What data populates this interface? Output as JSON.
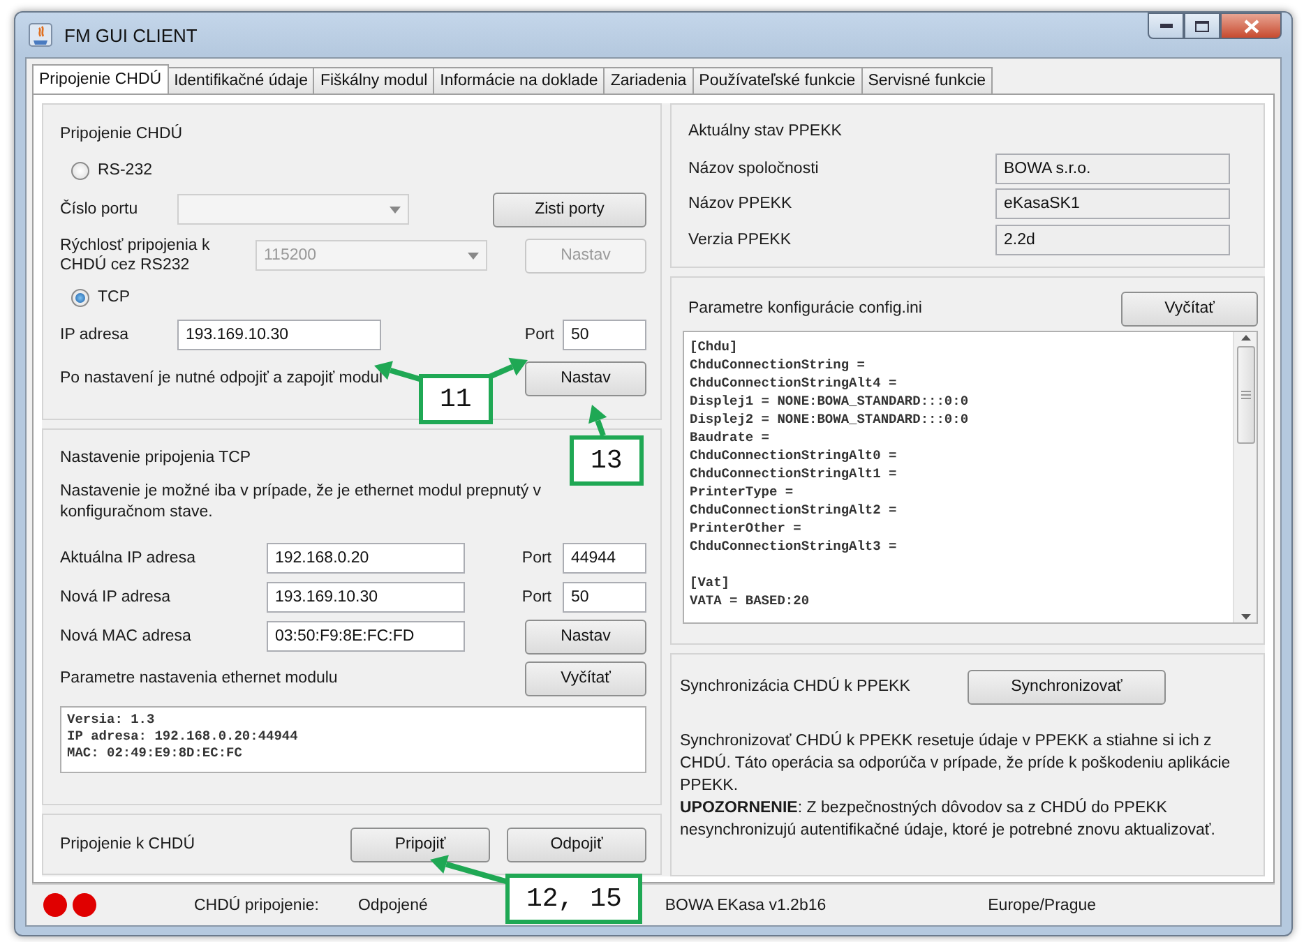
{
  "window": {
    "title": "FM GUI CLIENT"
  },
  "tabs": [
    {
      "label": "Pripojenie CHDÚ",
      "selected": true
    },
    {
      "label": "Identifikačné údaje",
      "selected": false
    },
    {
      "label": "Fiškálny modul",
      "selected": false
    },
    {
      "label": "Informácie na doklade",
      "selected": false
    },
    {
      "label": "Zariadenia",
      "selected": false
    },
    {
      "label": "Používateľské funkcie",
      "selected": false
    },
    {
      "label": "Servisné funkcie",
      "selected": false
    }
  ],
  "connection": {
    "title": "Pripojenie CHDÚ",
    "rs232": {
      "label": "RS-232",
      "selected": false
    },
    "port": {
      "label": "Číslo portu",
      "disabled": true
    },
    "detect_button": {
      "label": "Zisti porty",
      "disabled": false
    },
    "speed": {
      "label": "Rýchlosť pripojenia k CHDÚ cez RS232",
      "value": "115200",
      "disabled": true
    },
    "speed_button": {
      "label": "Nastav",
      "disabled": true
    },
    "tcp": {
      "label": "TCP",
      "selected": true
    },
    "ip": {
      "label": "IP adresa",
      "value": "193.169.10.30"
    },
    "tcp_port": {
      "label": "Port",
      "value": "50"
    },
    "note": "Po nastavení je nutné odpojiť a zapojiť modul",
    "set_button": {
      "label": "Nastav",
      "disabled": false
    }
  },
  "tcp_settings": {
    "title": "Nastavenie pripojenia TCP",
    "description": "Nastavenie je možné iba v prípade, že je ethernet modul prepnutý v konfiguračnom stave.",
    "rows": [
      {
        "kind": "port",
        "label": "Aktuálna IP adresa",
        "value": "192.168.0.20",
        "port_label": "Port",
        "port_value": "44944"
      },
      {
        "kind": "port",
        "label": "Nová IP adresa",
        "value": "193.169.10.30",
        "port_label": "Port",
        "port_value": "50"
      },
      {
        "kind": "button",
        "label": "Nová MAC adresa",
        "value": "03:50:F9:8E:FC:FD",
        "button": "Nastav"
      }
    ],
    "params_label": "Parametre nastavenia ethernet modulu",
    "read_button": "Vyčítať",
    "output": [
      "Versia: 1.3",
      "IP adresa: 192.168.0.20:44944",
      "MAC: 02:49:E9:8D:EC:FC"
    ]
  },
  "connect": {
    "label": "Pripojenie k CHDÚ",
    "buttons": [
      "Pripojiť",
      "Odpojiť"
    ]
  },
  "ppekk_state": {
    "title": "Aktuálny stav PPEKK",
    "rows": [
      {
        "label": "Názov spoločnosti",
        "value": "BOWA s.r.o."
      },
      {
        "label": "Názov PPEKK",
        "value": "eKasaSK1"
      },
      {
        "label": "Verzia PPEKK",
        "value": "2.2d"
      }
    ]
  },
  "config": {
    "title": "Parametre konfigurácie config.ini",
    "button": "Vyčítať",
    "sections": [
      {
        "lines": [
          "[Chdu]",
          "ChduConnectionString =",
          "ChduConnectionStringAlt4 =",
          "Displej1 = NONE:BOWA_STANDARD:::0:0",
          "Displej2 = NONE:BOWA_STANDARD:::0:0",
          "Baudrate =",
          "ChduConnectionStringAlt0 =",
          "ChduConnectionStringAlt1 =",
          "PrinterType =",
          "ChduConnectionStringAlt2 =",
          "PrinterOther =",
          "ChduConnectionStringAlt3 ="
        ]
      },
      {
        "lines": [
          "[Vat]",
          "VATA = BASED:20"
        ]
      }
    ]
  },
  "sync": {
    "title": "Synchronizácia CHDÚ k PPEKK",
    "button": "Synchronizovať",
    "paragraphs": [
      "Synchronizovať CHDÚ k PPEKK resetuje údaje v PPEKK a stiahne si ich z CHDÚ. Táto operácia sa odporúča v prípade, že príde k poškodeniu aplikácie PPEKK.",
      "**UPOZORNENIE**: Z bezpečnostných dôvodov sa z CHDÚ do PPEKK nesynchronizujú autentifikačné údaje, ktoré je potrebné znovu aktualizovať."
    ]
  },
  "status_bar": {
    "indicators": [
      {
        "color": "#e00000"
      },
      {
        "color": "#e00000"
      }
    ],
    "connection_label": "CHDÚ pripojenie:",
    "connection_value": "Odpojené",
    "version": "BOWA EKasa v1.2b16",
    "timezone": "Europe/Prague"
  },
  "annotations": [
    {
      "label": "11"
    },
    {
      "label": "13"
    },
    {
      "label": "12, 15"
    }
  ]
}
